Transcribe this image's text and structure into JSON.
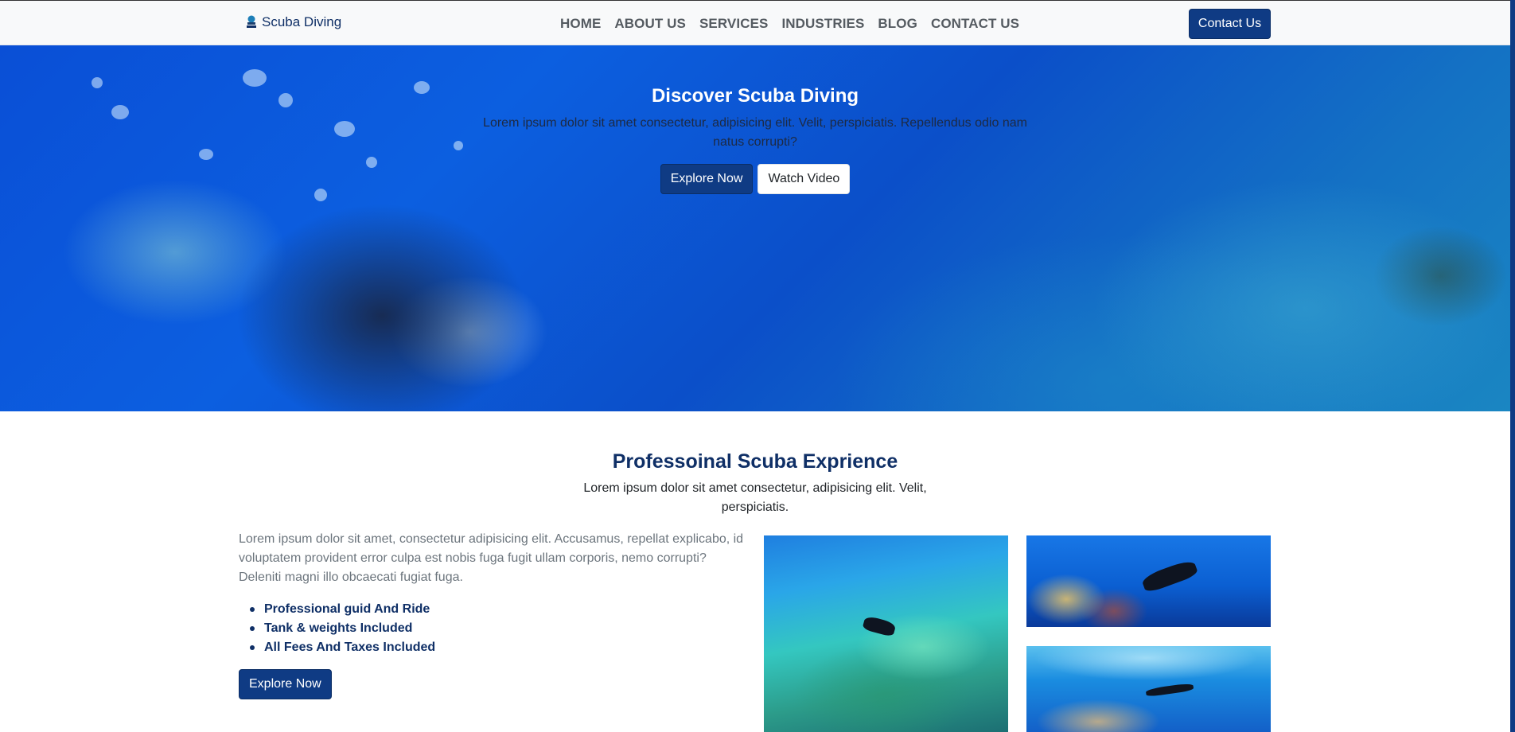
{
  "navbar": {
    "brand": "Scuba Diving",
    "brand_icon": "scuba-logo-icon",
    "links": [
      "HOME",
      "ABOUT US",
      "SERVICES",
      "INDUSTRIES",
      "BLOG",
      "CONTACT US"
    ],
    "contact_button": "Contact Us"
  },
  "hero": {
    "title": "Discover Scuba Diving",
    "text": "Lorem ipsum dolor sit amet consectetur, adipisicing elit. Velit, perspiciatis. Repellendus odio nam natus corrupti?",
    "primary_button": "Explore Now",
    "secondary_button": "Watch Video"
  },
  "experience": {
    "title": "Professoinal Scuba Exprience",
    "subtitle": "Lorem ipsum dolor sit amet consectetur, adipisicing elit. Velit, perspiciatis.",
    "body": "Lorem ipsum dolor sit amet, consectetur adipisicing elit. Accusamus, repellat explicabo, id voluptatem provident error culpa est nobis fuga fugit ullam corporis, nemo corrupti? Deleniti magni illo obcaecati fugiat fuga.",
    "features": [
      "Professional guid And Ride",
      "Tank & weights Included",
      "All Fees And Taxes Included"
    ],
    "button": "Explore Now"
  },
  "colors": {
    "primary": "#0f3b84",
    "heading": "#0f2f66",
    "navbar_bg": "#f8f9fa"
  }
}
